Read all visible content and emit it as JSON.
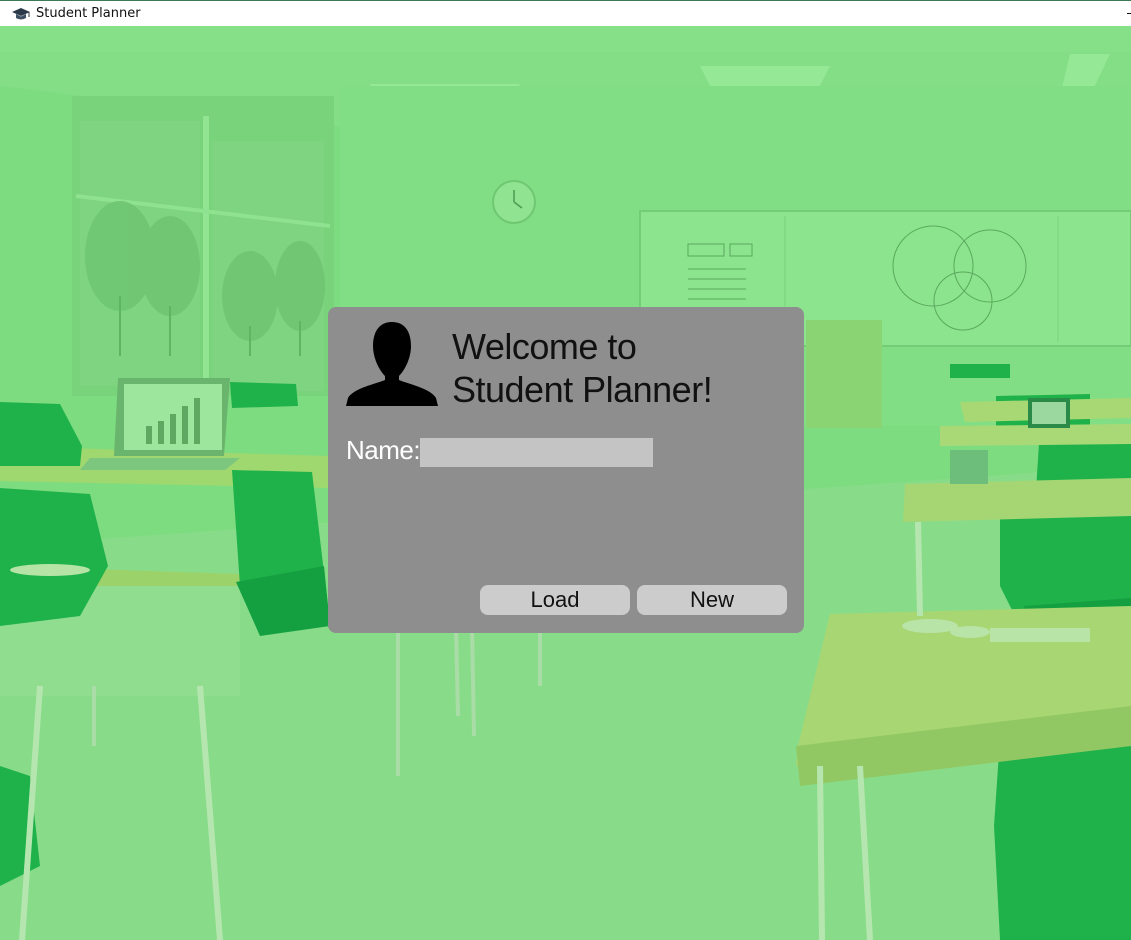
{
  "window": {
    "title": "Student Planner",
    "icon": "graduation-cap-icon"
  },
  "dialog": {
    "avatar_icon": "user-silhouette-icon",
    "welcome_line1": "Welcome to",
    "welcome_line2": "Student Planner!",
    "name_label": "Name:",
    "name_value": "",
    "name_placeholder": "",
    "load_label": "Load",
    "new_label": "New"
  },
  "colors": {
    "overlay_green": "#7edc80",
    "dialog_bg": "#8e8e8e",
    "input_bg": "#c4c4c4",
    "button_bg": "#cccccc"
  }
}
